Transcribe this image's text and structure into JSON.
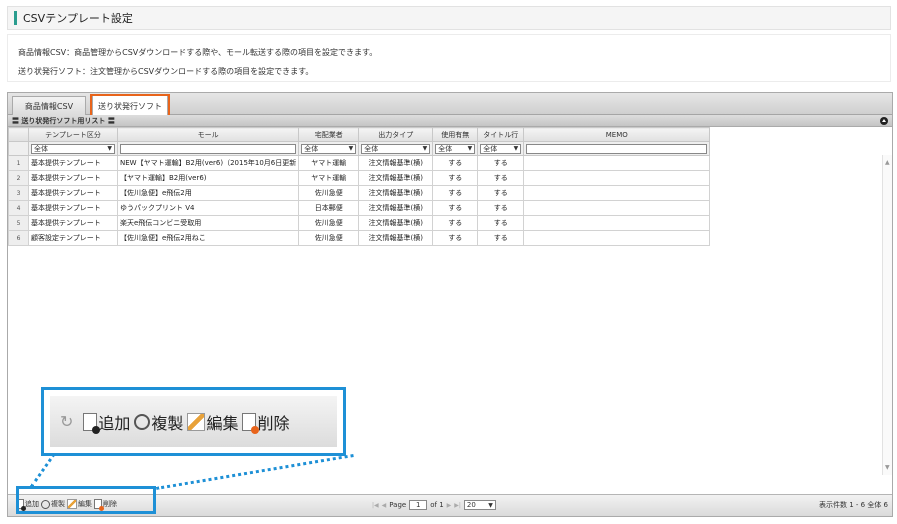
{
  "header": {
    "title": "CSVテンプレート設定"
  },
  "description": {
    "line1": "商品情報CSV：商品管理からCSVダウンロードする際や、モール転送する際の項目を設定できます。",
    "line2": "送り状発行ソフト：注文管理からCSVダウンロードする際の項目を設定できます。"
  },
  "tabs": [
    {
      "label": "商品情報CSV"
    },
    {
      "label": "送り状発行ソフト"
    }
  ],
  "grid": {
    "caption": "〓 送り状発行ソフト用リスト 〓",
    "columns": [
      "テンプレート区分",
      "モール",
      "宅配業者",
      "出力タイプ",
      "使用有無",
      "タイトル行",
      "MEMO"
    ],
    "filters": {
      "kubun": "全体",
      "mall": "",
      "carrier": "全体",
      "output": "全体",
      "use": "全体",
      "title": "全体",
      "memo": ""
    },
    "rows": [
      {
        "n": "1",
        "kubun": "基本提供テンプレート",
        "mall": "NEW【ヤマト運輸】B2用(ver6)（2015年10月6日更新",
        "carrier": "ヤマト運輸",
        "output": "注文情報基準(横)",
        "use": "する",
        "title": "する",
        "memo": ""
      },
      {
        "n": "2",
        "kubun": "基本提供テンプレート",
        "mall": "【ヤマト運輸】B2用(ver6)",
        "carrier": "ヤマト運輸",
        "output": "注文情報基準(横)",
        "use": "する",
        "title": "する",
        "memo": ""
      },
      {
        "n": "3",
        "kubun": "基本提供テンプレート",
        "mall": "【佐川急便】e飛伝2用",
        "carrier": "佐川急便",
        "output": "注文情報基準(横)",
        "use": "する",
        "title": "する",
        "memo": ""
      },
      {
        "n": "4",
        "kubun": "基本提供テンプレート",
        "mall": "ゆうパックプリント V4",
        "carrier": "日本郵便",
        "output": "注文情報基準(横)",
        "use": "する",
        "title": "する",
        "memo": ""
      },
      {
        "n": "5",
        "kubun": "基本提供テンプレート",
        "mall": "楽天e飛伝コンビニ受取用",
        "carrier": "佐川急便",
        "output": "注文情報基準(横)",
        "use": "する",
        "title": "する",
        "memo": ""
      },
      {
        "n": "6",
        "kubun": "顧客設定テンプレート",
        "mall": "【佐川急便】e飛伝2用ねこ",
        "carrier": "佐川急便",
        "output": "注文情報基準(横)",
        "use": "する",
        "title": "する",
        "memo": ""
      }
    ]
  },
  "toolbar": {
    "add": "追加",
    "copy": "複製",
    "edit": "編集",
    "delete": "削除"
  },
  "pager": {
    "page_label": "Page",
    "page": "1",
    "of_label": "of 1",
    "page_size": "20",
    "info": "表示件数 1 - 6 全体 6"
  },
  "colors": {
    "accent": "#e8641b",
    "callout": "#1e90d6",
    "header_bar": "#2a9d8f"
  }
}
